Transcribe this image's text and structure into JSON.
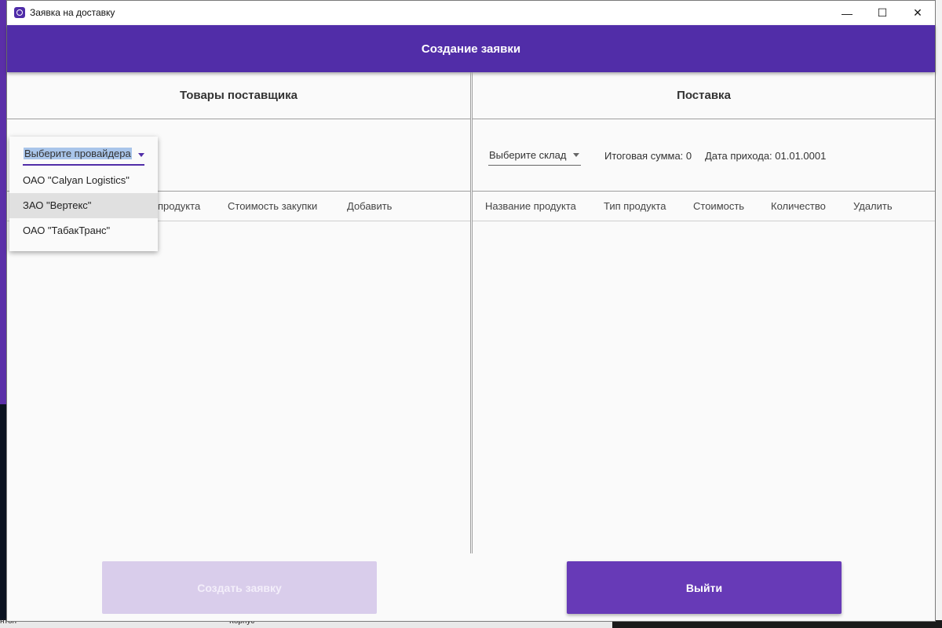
{
  "window": {
    "title": "Заявка на доставку",
    "controls": {
      "minimize": "—",
      "maximize": "☐",
      "close": "✕"
    }
  },
  "appbar": {
    "title": "Создание заявки"
  },
  "left_panel": {
    "title": "Товары поставщика",
    "provider_select": {
      "placeholder": "Выберите провайдера",
      "options": [
        "ОАО \"Calyan Logistics\"",
        "ЗАО \"Вертекс\"",
        "ОАО \"ТабакТранс\""
      ],
      "hovered_option": "ЗАО \"Вертекс\""
    },
    "columns": [
      "продукта",
      "Стоимость закупки",
      "Добавить"
    ]
  },
  "right_panel": {
    "title": "Поставка",
    "warehouse_select": {
      "placeholder": "Выберите склад"
    },
    "total": "Итоговая сумма: 0",
    "arrival_date": "Дата прихода: 01.01.0001",
    "columns": [
      "Название продукта",
      "Тип продукта",
      "Стоимость",
      "Количество",
      "Удалить"
    ]
  },
  "buttons": {
    "create_request": "Создать заявку",
    "exit": "Выйти"
  },
  "desktop": {
    "label_left": "нтон",
    "label_center": "Корпус"
  },
  "colors": {
    "primary": "#512da8",
    "button": "#673ab7",
    "button_disabled": "#d9cdeb"
  }
}
